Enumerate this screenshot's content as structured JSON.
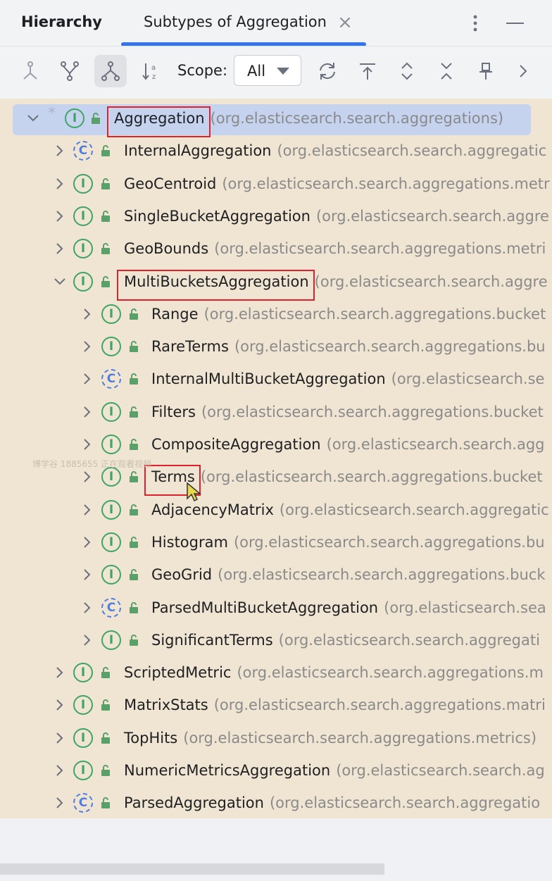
{
  "header": {
    "panel_title": "Hierarchy",
    "tab_label": "Subtypes of Aggregation",
    "close_glyph": "×",
    "accent_color": "#3574f0"
  },
  "toolbar": {
    "buttons": [
      {
        "name": "supertypes-hierarchy-button",
        "icon": "supertypes-icon"
      },
      {
        "name": "class-hierarchy-button",
        "icon": "class-hierarchy-icon"
      },
      {
        "name": "subtypes-hierarchy-button",
        "icon": "subtypes-icon",
        "active": true
      },
      {
        "name": "sort-alphabetically-button",
        "icon": "sort-alpha-icon"
      },
      {
        "name": "refresh-button",
        "icon": "refresh-icon"
      },
      {
        "name": "export-button",
        "icon": "export-icon"
      },
      {
        "name": "expand-all-button",
        "icon": "expand-all-icon"
      },
      {
        "name": "collapse-all-button",
        "icon": "collapse-all-icon"
      },
      {
        "name": "pin-tab-button",
        "icon": "pin-icon"
      },
      {
        "name": "more-actions-button",
        "icon": "chevron-right-icon"
      }
    ],
    "scope_label": "Scope:",
    "scope_value": "All"
  },
  "tree": {
    "colors": {
      "background": "#f0e5d2",
      "selection": "#c5d3ef",
      "highlight_box": "#e0202a"
    },
    "nodes": [
      {
        "name": "Aggregation",
        "package": "(org.elasticsearch.search.aggregations)",
        "kind": "interface",
        "depth": 0,
        "expanded": true,
        "selected": true,
        "highlighted": true,
        "starred": true
      },
      {
        "name": "InternalAggregation",
        "package": "(org.elasticsearch.search.aggregatic",
        "kind": "class",
        "depth": 1,
        "expanded": false
      },
      {
        "name": "GeoCentroid",
        "package": "(org.elasticsearch.search.aggregations.metr",
        "kind": "interface",
        "depth": 1,
        "expanded": false
      },
      {
        "name": "SingleBucketAggregation",
        "package": "(org.elasticsearch.search.aggre",
        "kind": "interface",
        "depth": 1,
        "expanded": false
      },
      {
        "name": "GeoBounds",
        "package": "(org.elasticsearch.search.aggregations.metri",
        "kind": "interface",
        "depth": 1,
        "expanded": false
      },
      {
        "name": "MultiBucketsAggregation",
        "package": "(org.elasticsearch.search.aggre",
        "kind": "interface",
        "depth": 1,
        "expanded": true,
        "highlighted": true
      },
      {
        "name": "Range",
        "package": "(org.elasticsearch.search.aggregations.bucket",
        "kind": "interface",
        "depth": 2,
        "expanded": false
      },
      {
        "name": "RareTerms",
        "package": "(org.elasticsearch.search.aggregations.bu",
        "kind": "interface",
        "depth": 2,
        "expanded": false
      },
      {
        "name": "InternalMultiBucketAggregation",
        "package": "(org.elasticsearch.se",
        "kind": "class",
        "depth": 2,
        "expanded": false
      },
      {
        "name": "Filters",
        "package": "(org.elasticsearch.search.aggregations.bucket",
        "kind": "interface",
        "depth": 2,
        "expanded": false
      },
      {
        "name": "CompositeAggregation",
        "package": "(org.elasticsearch.search.agg",
        "kind": "interface",
        "depth": 2,
        "expanded": false
      },
      {
        "name": "Terms",
        "package": "(org.elasticsearch.search.aggregations.bucket",
        "kind": "interface",
        "depth": 2,
        "expanded": false,
        "highlighted": true
      },
      {
        "name": "AdjacencyMatrix",
        "package": "(org.elasticsearch.search.aggregatic",
        "kind": "interface",
        "depth": 2,
        "expanded": false
      },
      {
        "name": "Histogram",
        "package": "(org.elasticsearch.search.aggregations.bu",
        "kind": "interface",
        "depth": 2,
        "expanded": false
      },
      {
        "name": "GeoGrid",
        "package": "(org.elasticsearch.search.aggregations.buck",
        "kind": "interface",
        "depth": 2,
        "expanded": false
      },
      {
        "name": "ParsedMultiBucketAggregation",
        "package": "(org.elasticsearch.sea",
        "kind": "class",
        "depth": 2,
        "expanded": false
      },
      {
        "name": "SignificantTerms",
        "package": "(org.elasticsearch.search.aggregati",
        "kind": "interface",
        "depth": 2,
        "expanded": false
      },
      {
        "name": "ScriptedMetric",
        "package": "(org.elasticsearch.search.aggregations.m",
        "kind": "interface",
        "depth": 1,
        "expanded": false
      },
      {
        "name": "MatrixStats",
        "package": "(org.elasticsearch.search.aggregations.matri",
        "kind": "interface",
        "depth": 1,
        "expanded": false
      },
      {
        "name": "TopHits",
        "package": "(org.elasticsearch.search.aggregations.metrics)",
        "kind": "interface",
        "depth": 1,
        "expanded": false
      },
      {
        "name": "NumericMetricsAggregation",
        "package": "(org.elasticsearch.search.ag",
        "kind": "interface",
        "depth": 1,
        "expanded": false
      },
      {
        "name": "ParsedAggregation",
        "package": "(org.elasticsearch.search.aggregatio",
        "kind": "class",
        "depth": 1,
        "expanded": false
      }
    ]
  },
  "watermark": "博学谷 1885655 正在观看视频"
}
